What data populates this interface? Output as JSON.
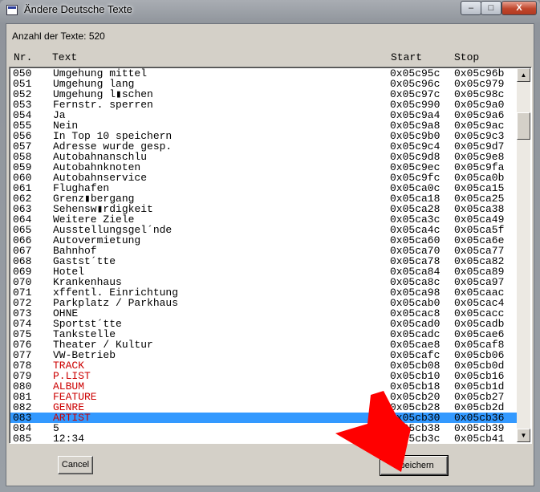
{
  "window": {
    "title": "Ändere Deutsche Texte",
    "minimize": "–",
    "maximize": "□",
    "close": "X"
  },
  "count_label": "Anzahl der Texte: 520",
  "columns": {
    "nr": "Nr.",
    "text": "Text",
    "start": "Start",
    "stop": "Stop"
  },
  "selected_nr": "083",
  "highlight_color": "#3399ff",
  "special_text_color": "#cc0000",
  "rows": [
    {
      "nr": "050",
      "text": "Umgehung mittel",
      "start": "0x05c95c",
      "stop": "0x05c96b"
    },
    {
      "nr": "051",
      "text": "Umgehung lang",
      "start": "0x05c96c",
      "stop": "0x05c979"
    },
    {
      "nr": "052",
      "text": "Umgehung l▮schen",
      "start": "0x05c97c",
      "stop": "0x05c98c"
    },
    {
      "nr": "053",
      "text": "Fernstr. sperren",
      "start": "0x05c990",
      "stop": "0x05c9a0"
    },
    {
      "nr": "054",
      "text": "Ja",
      "start": "0x05c9a4",
      "stop": "0x05c9a6"
    },
    {
      "nr": "055",
      "text": "Nein",
      "start": "0x05c9a8",
      "stop": "0x05c9ac"
    },
    {
      "nr": "056",
      "text": "In Top 10 speichern",
      "start": "0x05c9b0",
      "stop": "0x05c9c3"
    },
    {
      "nr": "057",
      "text": "Adresse wurde gesp.",
      "start": "0x05c9c4",
      "stop": "0x05c9d7"
    },
    {
      "nr": "058",
      "text": "Autobahnanschlu",
      "start": "0x05c9d8",
      "stop": "0x05c9e8"
    },
    {
      "nr": "059",
      "text": "Autobahnknoten",
      "start": "0x05c9ec",
      "stop": "0x05c9fa"
    },
    {
      "nr": "060",
      "text": "Autobahnservice",
      "start": "0x05c9fc",
      "stop": "0x05ca0b"
    },
    {
      "nr": "061",
      "text": "Flughafen",
      "start": "0x05ca0c",
      "stop": "0x05ca15"
    },
    {
      "nr": "062",
      "text": "Grenz▮bergang",
      "start": "0x05ca18",
      "stop": "0x05ca25"
    },
    {
      "nr": "063",
      "text": "Sehensw▮rdigkeit",
      "start": "0x05ca28",
      "stop": "0x05ca38"
    },
    {
      "nr": "064",
      "text": "Weitere Ziele",
      "start": "0x05ca3c",
      "stop": "0x05ca49"
    },
    {
      "nr": "065",
      "text": "Ausstellungsgel´nde",
      "start": "0x05ca4c",
      "stop": "0x05ca5f"
    },
    {
      "nr": "066",
      "text": "Autovermietung",
      "start": "0x05ca60",
      "stop": "0x05ca6e"
    },
    {
      "nr": "067",
      "text": "Bahnhof",
      "start": "0x05ca70",
      "stop": "0x05ca77"
    },
    {
      "nr": "068",
      "text": "Gastst´tte",
      "start": "0x05ca78",
      "stop": "0x05ca82"
    },
    {
      "nr": "069",
      "text": "Hotel",
      "start": "0x05ca84",
      "stop": "0x05ca89"
    },
    {
      "nr": "070",
      "text": "Krankenhaus",
      "start": "0x05ca8c",
      "stop": "0x05ca97"
    },
    {
      "nr": "071",
      "text": "xffentl. Einrichtung",
      "start": "0x05ca98",
      "stop": "0x05caac"
    },
    {
      "nr": "072",
      "text": "Parkplatz / Parkhaus",
      "start": "0x05cab0",
      "stop": "0x05cac4"
    },
    {
      "nr": "073",
      "text": "OHNE",
      "start": "0x05cac8",
      "stop": "0x05cacc"
    },
    {
      "nr": "074",
      "text": "Sportst´tte",
      "start": "0x05cad0",
      "stop": "0x05cadb"
    },
    {
      "nr": "075",
      "text": "Tankstelle",
      "start": "0x05cadc",
      "stop": "0x05cae6"
    },
    {
      "nr": "076",
      "text": "Theater / Kultur",
      "start": "0x05cae8",
      "stop": "0x05caf8"
    },
    {
      "nr": "077",
      "text": "VW-Betrieb",
      "start": "0x05cafc",
      "stop": "0x05cb06"
    },
    {
      "nr": "078",
      "text": "TRACK",
      "start": "0x05cb08",
      "stop": "0x05cb0d",
      "special": true
    },
    {
      "nr": "079",
      "text": "P.LIST",
      "start": "0x05cb10",
      "stop": "0x05cb16",
      "special": true
    },
    {
      "nr": "080",
      "text": "ALBUM",
      "start": "0x05cb18",
      "stop": "0x05cb1d",
      "special": true
    },
    {
      "nr": "081",
      "text": "FEATURE",
      "start": "0x05cb20",
      "stop": "0x05cb27",
      "special": true
    },
    {
      "nr": "082",
      "text": "GENRE",
      "start": "0x05cb28",
      "stop": "0x05cb2d",
      "special": true
    },
    {
      "nr": "083",
      "text": "ARTIST",
      "start": "0x05cb30",
      "stop": "0x05cb36",
      "special": true
    },
    {
      "nr": "084",
      "text": "5",
      "start": "0x05cb38",
      "stop": "0x05cb39"
    },
    {
      "nr": "085",
      "text": "12:34",
      "start": "0x05cb3c",
      "stop": "0x05cb41"
    }
  ],
  "buttons": {
    "cancel": "Cancel",
    "save": "Speichern"
  },
  "icons": {
    "scroll_up": "▲",
    "scroll_down": "▼"
  },
  "annotation": {
    "type": "red-arrow",
    "target": "Speichern",
    "color": "#ff0000"
  }
}
